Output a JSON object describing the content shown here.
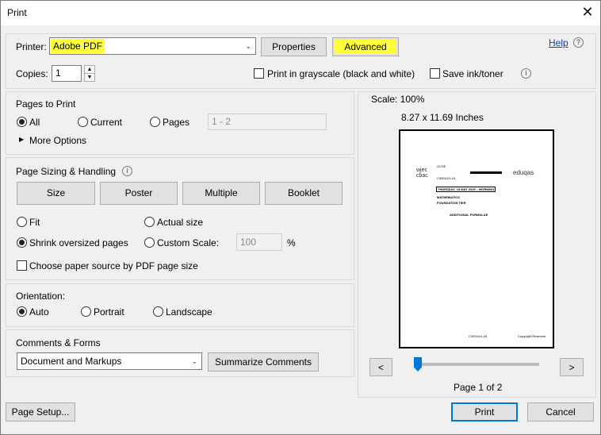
{
  "window": {
    "title": "Print",
    "close_glyph": "✕"
  },
  "printer": {
    "label": "Printer:",
    "selected": "Adobe PDF",
    "properties_button": "Properties",
    "advanced_button": "Advanced",
    "help_link": "Help",
    "copies_label": "Copies:",
    "copies_value": "1",
    "grayscale_label": "Print in grayscale (black and white)",
    "grayscale_checked": false,
    "save_ink_label": "Save ink/toner",
    "save_ink_checked": false,
    "highlight_color": "#ffff3b"
  },
  "pages_to_print": {
    "heading": "Pages to Print",
    "options": [
      "All",
      "Current",
      "Pages"
    ],
    "selected": "All",
    "pages_range_value": "1 - 2",
    "more_options": "More Options"
  },
  "page_sizing": {
    "heading": "Page Sizing & Handling",
    "tabs": [
      "Size",
      "Poster",
      "Multiple",
      "Booklet"
    ],
    "fit_label": "Fit",
    "actual_size_label": "Actual size",
    "shrink_label": "Shrink oversized pages",
    "custom_scale_label": "Custom Scale:",
    "custom_scale_value": "100",
    "percent_sign": "%",
    "selected": "Shrink oversized pages",
    "paper_source_label": "Choose paper source by PDF page size",
    "paper_source_checked": false
  },
  "orientation": {
    "heading": "Orientation:",
    "options": [
      "Auto",
      "Portrait",
      "Landscape"
    ],
    "selected": "Auto"
  },
  "comments_forms": {
    "heading": "Comments & Forms",
    "selected": "Document and Markups",
    "summarize_button": "Summarize Comments"
  },
  "preview": {
    "scale_text": "Scale: 100%",
    "size_text": "8.27 x 11.69 Inches",
    "page_indicator": "Page 1 of 2",
    "prev_glyph": "<",
    "next_glyph": ">",
    "slider_position": 0,
    "doc": {
      "logo_left_top": "wjec",
      "logo_left_bottom": "cbac",
      "line1": "GCSE",
      "line2": "C300U10-1A",
      "line3": "THURSDAY, 15 MAY 2025 – MORNING",
      "line4": "MATHEMATICS",
      "line5": "FOUNDATION TIER",
      "line6": "ADDITIONAL FORMULAE",
      "logo_right_top": "eduqas",
      "logo_right_sub": "",
      "footer_left": "C300U10-1A",
      "footer_right": "Copyright Reserved"
    }
  },
  "footer": {
    "page_setup_button": "Page Setup...",
    "print_button": "Print",
    "cancel_button": "Cancel"
  }
}
